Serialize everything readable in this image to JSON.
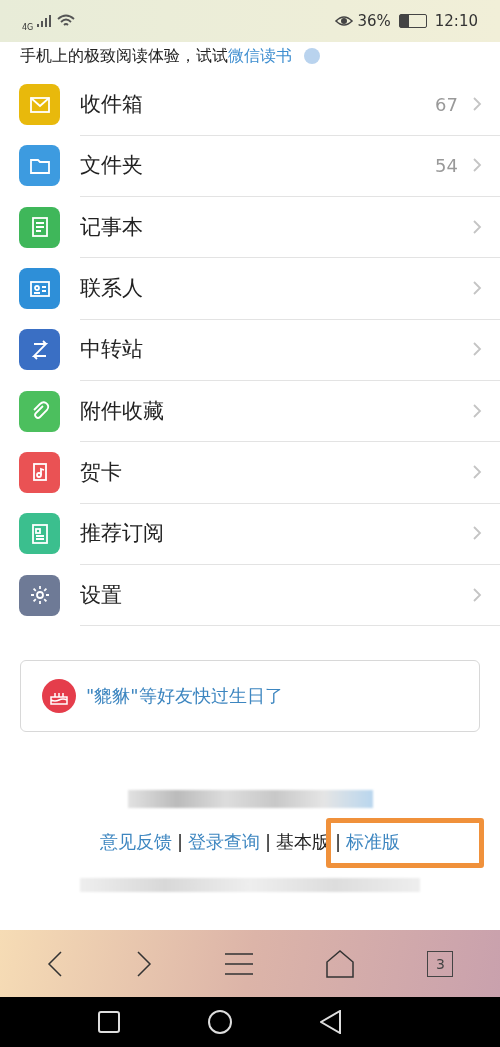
{
  "status_bar": {
    "network": "4G",
    "battery": "36%",
    "time": "12:10"
  },
  "banner": {
    "text": "手机上的极致阅读体验，试试",
    "link": "微信读书"
  },
  "menu": [
    {
      "label": "收件箱",
      "count": "67",
      "color": "#e8b90c"
    },
    {
      "label": "文件夹",
      "count": "54",
      "color": "#3d9be0"
    },
    {
      "label": "记事本",
      "color": "#3fb75a"
    },
    {
      "label": "联系人",
      "color": "#2e8fd8"
    },
    {
      "label": "中转站",
      "color": "#3a6fc4"
    },
    {
      "label": "附件收藏",
      "color": "#4cbf5e"
    },
    {
      "label": "贺卡",
      "color": "#ea5254"
    },
    {
      "label": "推荐订阅",
      "color": "#3bbf8e"
    },
    {
      "label": "设置",
      "color": "#6e7a96"
    }
  ],
  "birthday": {
    "text": "\"貔貅\"等好友快过生日了"
  },
  "footer": {
    "separator": "|",
    "links": [
      {
        "label": "意见反馈",
        "selected": false
      },
      {
        "label": "登录查询",
        "selected": false
      },
      {
        "label": "基本版",
        "selected": true
      },
      {
        "label": "标准版",
        "selected": false
      }
    ]
  },
  "browser_bar": {
    "tabs": "3"
  }
}
